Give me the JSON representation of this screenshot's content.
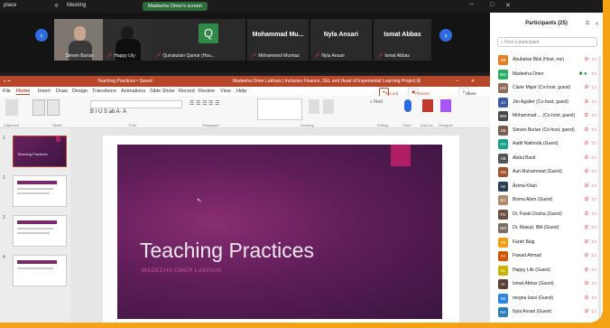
{
  "titlebar": {
    "app": "place",
    "meeting": "Meeting",
    "share_label": "Madeeha Omer's screen"
  },
  "video_strip": {
    "tiles": [
      {
        "name": "Steven Burian"
      },
      {
        "name": "Happy Lily"
      },
      {
        "avatar_letter": "Q",
        "name": "Qurratulain Qamar (Hou..."
      },
      {
        "big_name": "Mohammad Mu...",
        "name": "Mohammed Mumtaz"
      },
      {
        "big_name": "Nyla Ansari",
        "name": "Nyla Ansari"
      },
      {
        "big_name": "Ismat Abbas",
        "name": "Ismat Abbas"
      }
    ]
  },
  "ppt": {
    "doc_title": "Teaching Practices • Saved",
    "window_title": "Madeeha Omer Lakhani | Inclusive Finance, SEL and Head of Experiential Learning Project (EXP...",
    "tabs": [
      "File",
      "Home",
      "Insert",
      "Draw",
      "Design",
      "Transitions",
      "Animations",
      "Slide Show",
      "Record",
      "Review",
      "View",
      "Help"
    ],
    "record_label": "Record",
    "present_label": "Present in Teams",
    "share_label": "Share",
    "ribbon_groups": [
      "Clipboard",
      "Slides",
      "Font",
      "Paragraph",
      "Drawing",
      "Editing",
      "Voice",
      "Add-ins",
      "Designer"
    ],
    "slide_numbers": [
      "1",
      "2",
      "3",
      "4"
    ],
    "thumb1_title": "Teaching Practices",
    "slide_title": "Teaching Practices",
    "slide_subtitle": "MADEEHA OMER LAKHANI"
  },
  "participants": {
    "title": "Participants (25)",
    "search_placeholder": "Find a participant",
    "colors": {
      "mic_muted": "#e23b3b",
      "active": "#2f8a48",
      "accent": "#b7472a"
    },
    "list": [
      {
        "initials": "AB",
        "name": "Abubakar Bilal (Host, me)",
        "color": "#e67e22"
      },
      {
        "initials": "MO",
        "name": "Madeeha Omer",
        "color": "#27ae60"
      },
      {
        "initials": "CM",
        "name": "Claire Major (Co-host, guest)",
        "color": "#8e6b5a"
      },
      {
        "initials": "JA",
        "name": "Jim Agalter (Co-host, guest)",
        "color": "#3b5ba5"
      },
      {
        "initials": "MM",
        "name": "Mohammad ... (Co-host, guest)",
        "color": "#4a4a4a"
      },
      {
        "initials": "SB",
        "name": "Steven Burian (Co-host, guest)",
        "color": "#7a5c4f"
      },
      {
        "initials": "AN",
        "name": "Aadil Nakhoda (Guest)",
        "color": "#16a085"
      },
      {
        "initials": "AB",
        "name": "Abdul Basit",
        "color": "#555555"
      },
      {
        "initials": "AM",
        "name": "Aun Muhammad (Guest)",
        "color": "#a0522d"
      },
      {
        "initials": "AK",
        "name": "Azima Khan",
        "color": "#2c3e50"
      },
      {
        "initials": "BA",
        "name": "Bisma Alam (Guest)",
        "color": "#b08968"
      },
      {
        "initials": "FD",
        "name": "Dr. Farah Dosha (Guest)",
        "color": "#6d4c41"
      },
      {
        "initials": "DM",
        "name": "Dr. Masud, IBA (Guest)",
        "color": "#7b6f63"
      },
      {
        "initials": "FB",
        "name": "Farah Baig",
        "color": "#f39c12"
      },
      {
        "initials": "FA",
        "name": "Fawad Ahmad",
        "color": "#d35400"
      },
      {
        "initials": "HL",
        "name": "Happy Life (Guest)",
        "color": "#c9b400"
      },
      {
        "initials": "IA",
        "name": "Ismat Abbas (Guest)",
        "color": "#5d4037"
      },
      {
        "initials": "MI",
        "name": "megna Iassi (Guest)",
        "color": "#2e86de"
      },
      {
        "initials": "NA",
        "name": "Nyla Ansari (Guest)",
        "color": "#2980b9"
      }
    ]
  }
}
